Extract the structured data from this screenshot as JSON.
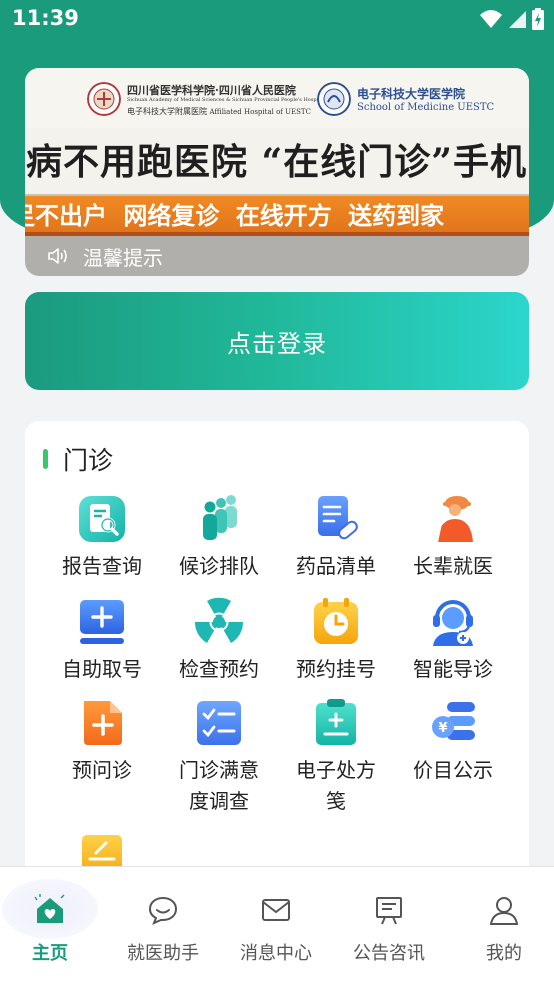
{
  "status_bar": {
    "time": "11:39"
  },
  "banner": {
    "institution_1": "四川省医学科学院·四川省人民医院",
    "institution_1_en": "Sichuan Academy of Medical Sciences & Sichuan Provincial People's Hospital",
    "institution_2": "电子科技大学附属医院",
    "institution_2_en": "Affiliated Hospital of UESTC",
    "institution_3": "电子科技大学医学院",
    "institution_3_en": "School of Medicine UESTC",
    "headline": "看病不用跑医院 “在线门诊”手机",
    "slogan": "足不出户  网络复诊  在线开方  送药到家",
    "notice": "温馨提示"
  },
  "login": {
    "label": "点击登录"
  },
  "outpatient": {
    "title": "门诊",
    "items": [
      {
        "label": "报告查询",
        "icon": "report-search-icon"
      },
      {
        "label": "候诊排队",
        "icon": "queue-people-icon"
      },
      {
        "label": "药品清单",
        "icon": "medicine-list-icon"
      },
      {
        "label": "长辈就医",
        "icon": "elder-care-icon"
      },
      {
        "label": "自助取号",
        "icon": "self-ticket-icon"
      },
      {
        "label": "检查预约",
        "icon": "radiation-exam-icon"
      },
      {
        "label": "预约挂号",
        "icon": "appointment-clock-icon"
      },
      {
        "label": "智能导诊",
        "icon": "smart-guide-headset-icon"
      },
      {
        "label": "预问诊",
        "icon": "pre-consult-icon"
      },
      {
        "label": "门诊满意度调查",
        "icon": "survey-checklist-icon"
      },
      {
        "label": "电子处方笺",
        "icon": "e-prescription-icon"
      },
      {
        "label": "价目公示",
        "icon": "price-list-icon"
      }
    ]
  },
  "bottom_nav": [
    {
      "label": "主页",
      "icon": "home-heart-icon",
      "active": true
    },
    {
      "label": "就医助手",
      "icon": "chat-bubble-icon",
      "active": false
    },
    {
      "label": "消息中心",
      "icon": "mail-icon",
      "active": false
    },
    {
      "label": "公告咨讯",
      "icon": "announcement-board-icon",
      "active": false
    },
    {
      "label": "我的",
      "icon": "user-profile-icon",
      "active": false
    }
  ],
  "colors": {
    "brand_green": "#1a9c7c",
    "active_tab": "#1a9c7c",
    "section_accent": "#38c76a"
  }
}
